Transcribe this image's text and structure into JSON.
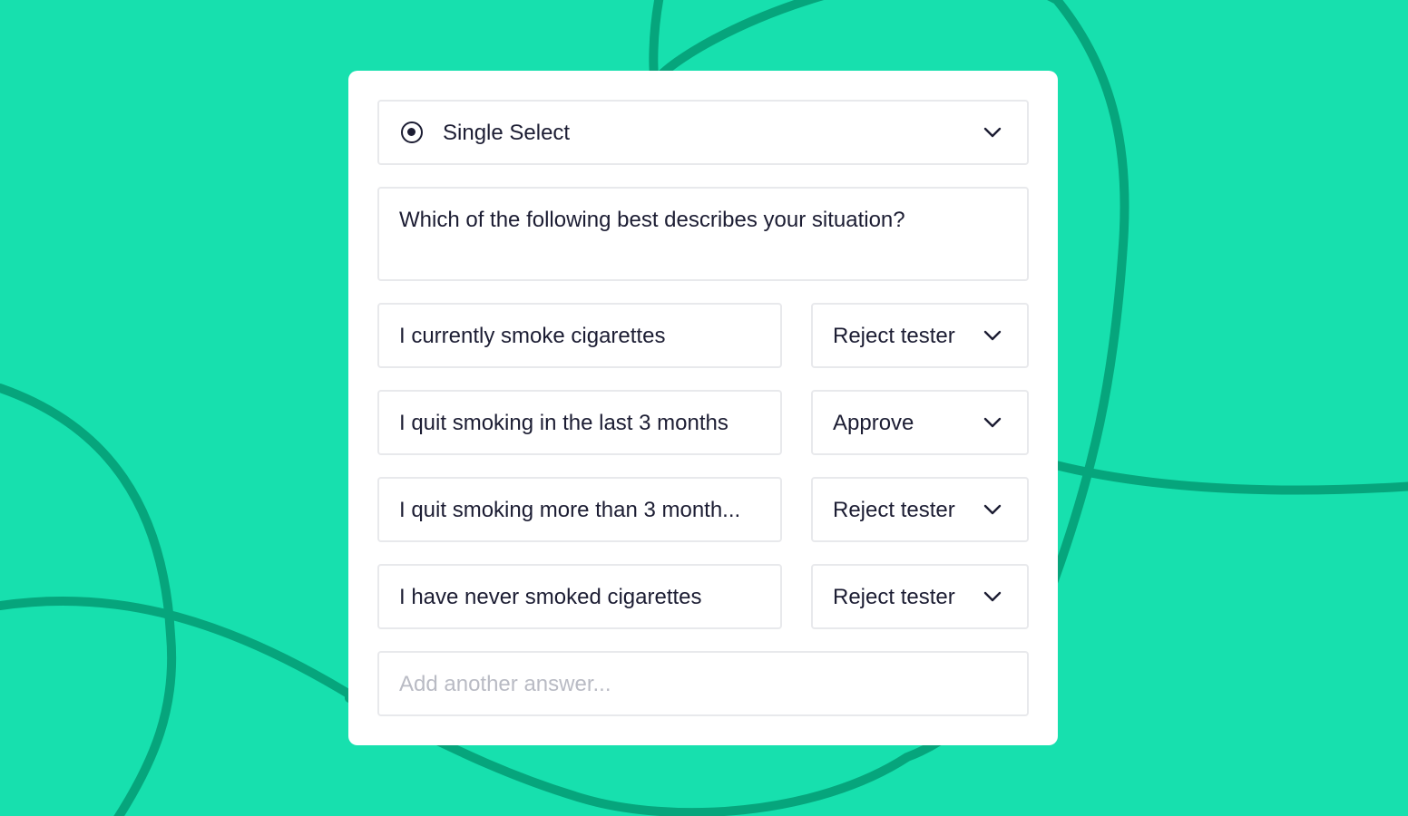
{
  "colors": {
    "background": "#17e0ae",
    "lines": "#06a57c",
    "card": "#ffffff",
    "field_border": "#e8e9ec",
    "text": "#1c1d33",
    "placeholder": "#b9bbc4"
  },
  "question_type": {
    "icon": "radio-selected-icon",
    "label": "Single Select",
    "dropdown_icon": "chevron-down-icon"
  },
  "question": {
    "text": "Which of the following best describes your situation?"
  },
  "answers": [
    {
      "text": "I currently smoke cigarettes",
      "rule": "Reject tester"
    },
    {
      "text": "I quit smoking in the last 3 months",
      "rule": "Approve"
    },
    {
      "text": "I quit smoking more than 3 month...",
      "rule": "Reject tester"
    },
    {
      "text": "I have never smoked cigarettes",
      "rule": "Reject tester"
    }
  ],
  "add_answer": {
    "placeholder": "Add another answer..."
  }
}
